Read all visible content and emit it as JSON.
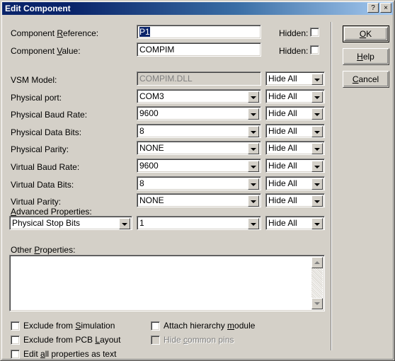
{
  "window": {
    "title": "Edit Component",
    "help_btn": "?",
    "close_btn": "×"
  },
  "form": {
    "reference": {
      "label_pre": "Component ",
      "label_accel": "R",
      "label_post": "eference:",
      "value": "P1",
      "hidden_label": "Hidden:",
      "hidden_checked": false
    },
    "value_row": {
      "label_pre": "Component ",
      "label_accel": "V",
      "label_post": "alue:",
      "value": "COMPIM",
      "hidden_label": "Hidden:",
      "hidden_checked": false
    },
    "rows": [
      {
        "label": "VSM Model:",
        "value": "COMPIM.DLL",
        "disabled": true,
        "combo": false,
        "hide": "Hide All"
      },
      {
        "label": "Physical port:",
        "value": "COM3",
        "disabled": false,
        "combo": true,
        "hide": "Hide All"
      },
      {
        "label": "Physical Baud Rate:",
        "value": "9600",
        "disabled": false,
        "combo": true,
        "hide": "Hide All"
      },
      {
        "label": "Physical Data Bits:",
        "value": "8",
        "disabled": false,
        "combo": true,
        "hide": "Hide All"
      },
      {
        "label": "Physical Parity:",
        "value": "NONE",
        "disabled": false,
        "combo": true,
        "hide": "Hide All"
      },
      {
        "label": "Virtual Baud Rate:",
        "value": "9600",
        "disabled": false,
        "combo": true,
        "hide": "Hide All"
      },
      {
        "label": "Virtual Data Bits:",
        "value": "8",
        "disabled": false,
        "combo": true,
        "hide": "Hide All"
      },
      {
        "label": "Virtual Parity:",
        "value": "NONE",
        "disabled": false,
        "combo": true,
        "hide": "Hide All"
      }
    ],
    "advanced": {
      "label": "Advanced Properties:",
      "property": "Physical Stop Bits",
      "value": "1",
      "hide": "Hide All"
    },
    "other_properties": {
      "label_pre": "Other ",
      "label_accel": "P",
      "label_post": "roperties:",
      "value": ""
    }
  },
  "checkboxes": {
    "left": [
      {
        "pre": "Exclude from ",
        "accel": "S",
        "post": "imulation",
        "checked": false,
        "disabled": false
      },
      {
        "pre": "Exclude from PCB ",
        "accel": "L",
        "post": "ayout",
        "checked": false,
        "disabled": false
      },
      {
        "pre": "Edit ",
        "accel": "a",
        "post": "ll properties as text",
        "checked": false,
        "disabled": false
      }
    ],
    "right": [
      {
        "pre": "Attach hierarchy ",
        "accel": "m",
        "post": "odule",
        "checked": false,
        "disabled": false
      },
      {
        "pre": "Hide ",
        "accel": "c",
        "post": "ommon pins",
        "checked": false,
        "disabled": true
      }
    ]
  },
  "buttons": {
    "ok": {
      "pre": "",
      "accel": "O",
      "post": "K"
    },
    "help": {
      "pre": "",
      "accel": "H",
      "post": "elp"
    },
    "cancel": {
      "pre": "",
      "accel": "C",
      "post": "ancel"
    }
  },
  "colors": {
    "face": "#d4d0c8",
    "title_start": "#0a246a",
    "title_end": "#a6caf0",
    "selection": "#0a246a",
    "disabled_text": "#808080"
  }
}
